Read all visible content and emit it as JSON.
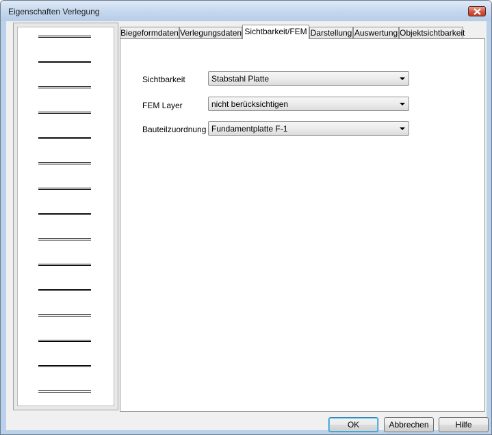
{
  "window": {
    "title": "Eigenschaften Verlegung"
  },
  "tabs": [
    {
      "label": "Biegeformdaten"
    },
    {
      "label": "Verlegungsdaten"
    },
    {
      "label": "Sichtbarkeit/FEM"
    },
    {
      "label": "Darstellung"
    },
    {
      "label": "Auswertung"
    },
    {
      "label": "Objektsichtbarkeit"
    }
  ],
  "active_tab": "Sichtbarkeit/FEM",
  "fields": [
    {
      "label": "Sichtbarkeit",
      "value": "Stabstahl Platte"
    },
    {
      "label": "FEM Layer",
      "value": "nicht berücksichtigen"
    },
    {
      "label": "Bauteilzuordnung",
      "value": "Fundamentplatte F-1"
    }
  ],
  "buttons": {
    "ok": "OK",
    "cancel": "Abbrechen",
    "help": "Hilfe"
  },
  "icons": {
    "close": "close-icon",
    "dropdown": "chevron-down-icon"
  }
}
